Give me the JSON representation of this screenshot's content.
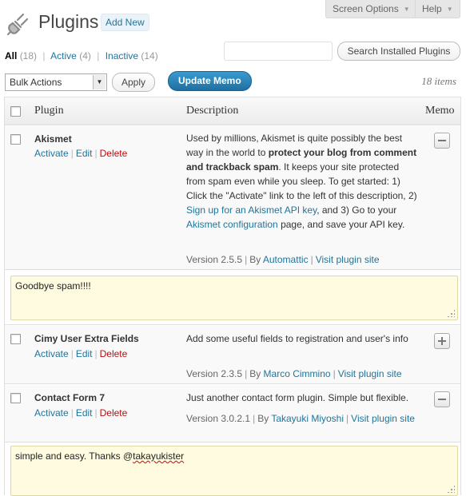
{
  "topbar": {
    "screen_options": "Screen Options",
    "help": "Help"
  },
  "header": {
    "title": "Plugins",
    "add_new": "Add New"
  },
  "filters": {
    "all_label": "All",
    "all_count": "(18)",
    "active_label": "Active",
    "active_count": "(4)",
    "inactive_label": "Inactive",
    "inactive_count": "(14)",
    "separator": "|"
  },
  "search": {
    "value": "",
    "button": "Search Installed Plugins"
  },
  "bulk": {
    "selected": "Bulk Actions",
    "apply": "Apply",
    "update_memo": "Update Memo",
    "items_count": "18 items"
  },
  "columns": {
    "plugin": "Plugin",
    "description": "Description",
    "memo": "Memo"
  },
  "actions": {
    "activate": "Activate",
    "edit": "Edit",
    "delete": "Delete",
    "sep": "|"
  },
  "plugins": [
    {
      "name": "Akismet",
      "desc_a": "Used by millions, Akismet is quite possibly the best way in the world to ",
      "desc_b": "protect your blog from comment and trackback spam",
      "desc_c": ". It keeps your site protected from spam even while you sleep. To get started: 1) Click the \"Activate\" link to the left of this description, 2) ",
      "desc_link1": "Sign up for an Akismet API key",
      "desc_d": ", and 3) Go to your ",
      "desc_link2": "Akismet configuration",
      "desc_e": " page, and save your API key.",
      "version": "Version 2.5.5",
      "by": "By",
      "author": "Automattic",
      "site": "Visit plugin site",
      "memo": "Goodbye spam!!!!"
    },
    {
      "name": "Cimy User Extra Fields",
      "desc": "Add some useful fields to registration and user's info",
      "version": "Version 2.3.5",
      "by": "By",
      "author": "Marco Cimmino",
      "site": "Visit plugin site"
    },
    {
      "name": "Contact Form 7",
      "desc": "Just another contact form plugin. Simple but flexible.",
      "version": "Version 3.0.2.1",
      "by": "By",
      "author": "Takayuki Miyoshi",
      "site": "Visit plugin site",
      "memo_a": "simple and easy. Thanks @",
      "memo_b": "takayukister"
    }
  ],
  "colors": {
    "link": "#21759b",
    "delete": "#bc0b0b",
    "memo_bg": "#fffbe0",
    "primary_button": "#2a80b6"
  }
}
